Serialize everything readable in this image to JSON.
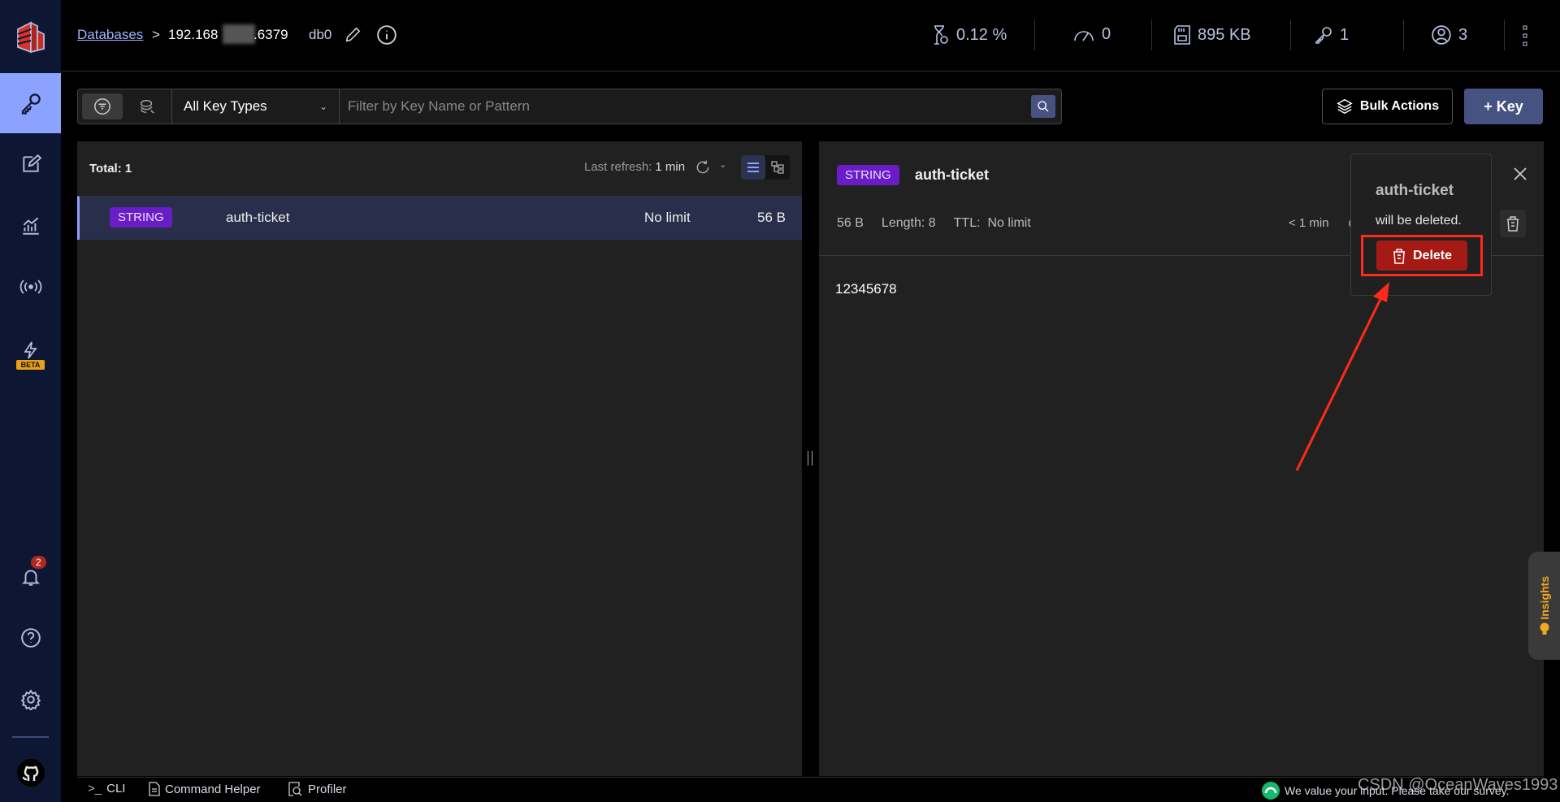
{
  "header": {
    "breadcrumb_link": "Databases",
    "separator": ">",
    "host": "192.168",
    "port": ".6379",
    "db": "db0",
    "stats": [
      {
        "icon": "hourglass-icon",
        "value": "0.12 %"
      },
      {
        "icon": "gauge-icon",
        "value": "0"
      },
      {
        "icon": "memory-icon",
        "value": "895 KB"
      },
      {
        "icon": "key-icon",
        "value": "1"
      },
      {
        "icon": "user-icon",
        "value": "3"
      }
    ]
  },
  "sidebar": {
    "beta_label": "BETA",
    "notification_count": "2"
  },
  "toolbar": {
    "key_type": "All Key Types",
    "search_placeholder": "Filter by Key Name or Pattern",
    "bulk_actions": "Bulk Actions",
    "add_key": "+ Key"
  },
  "list": {
    "total": "Total: 1",
    "last_refresh_label": "Last refresh:",
    "last_refresh_value": "1 min",
    "rows": [
      {
        "type": "STRING",
        "name": "auth-ticket",
        "ttl": "No limit",
        "size": "56 B"
      }
    ]
  },
  "details": {
    "type": "STRING",
    "name": "auth-ticket",
    "size": "56 B",
    "length": "Length: 8",
    "ttl_label": "TTL:",
    "ttl_value": "No limit",
    "refreshed": "< 1 min",
    "value": "12345678"
  },
  "popover": {
    "key": "auth-ticket",
    "message": "will be deleted.",
    "delete_label": "Delete"
  },
  "insights": {
    "label": "Insights"
  },
  "footer": {
    "cli": "CLI",
    "command_helper": "Command Helper",
    "profiler": "Profiler",
    "survey": "We value your input. Please take our survey."
  },
  "watermark": "CSDN @OceanWaves1993",
  "colors": {
    "accent": "#465282",
    "badge": "#6a1dc6",
    "delete": "#a51a14",
    "annotation": "#ff2a1a",
    "sidebar": "#0d1633",
    "active_nav": "#8ba2ff"
  }
}
